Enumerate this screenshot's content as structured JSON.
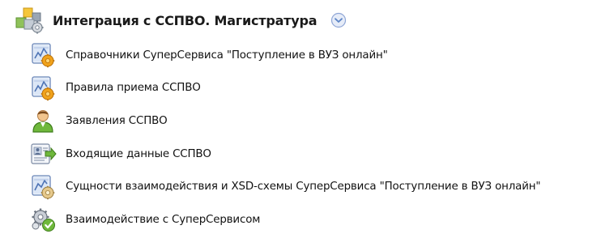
{
  "header": {
    "title": "Интеграция с ССПВО. Магистратура",
    "icon": "module-blocks-icon",
    "collapse_icon": "chevron-down-circle-icon"
  },
  "items": [
    {
      "label": "Справочники СуперСервиса \"Поступление в ВУЗ онлайн\"",
      "icon": "catalog-chart-gear-icon"
    },
    {
      "label": "Правила приема ССПВО",
      "icon": "catalog-chart-gear-icon"
    },
    {
      "label": "Заявления ССПВО",
      "icon": "user-green-icon"
    },
    {
      "label": "Входящие данные ССПВО",
      "icon": "incoming-card-arrow-icon"
    },
    {
      "label": "Сущности взаимодействия и XSD-схемы СуперСервиса \"Поступление в ВУЗ онлайн\"",
      "icon": "schema-chart-gear-icon"
    },
    {
      "label": "Взаимодействие с СуперСервисом",
      "icon": "gears-check-icon"
    }
  ],
  "colors": {
    "accent_blue": "#5b84c6",
    "icon_orange": "#f0a21b",
    "icon_green": "#6fb83c"
  }
}
